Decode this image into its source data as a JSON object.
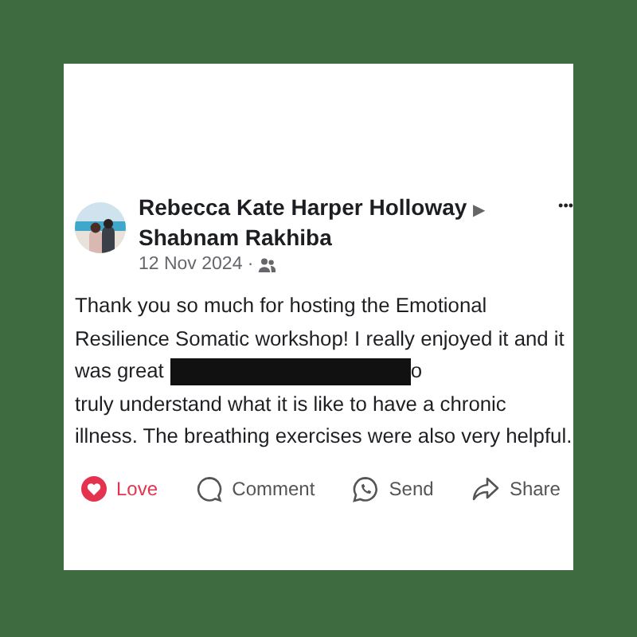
{
  "post": {
    "author": "Rebecca Kate Harper Holloway",
    "separator": "▶",
    "recipient": "Shabnam Rakhiba",
    "date": "12 Nov 2024 ·",
    "more": "•••",
    "lines": [
      {
        "text": "Thank you so much for hosting the Emotional",
        "redacted": false
      },
      {
        "text": "Resilience Somatic workshop! I really enjoyed it and it",
        "redacted": false
      },
      {
        "text": "was great",
        "redacted": true,
        "tail": "o"
      },
      {
        "text": "truly understand what it is like to have a chronic",
        "redacted": false
      },
      {
        "text": "illness. The breathing exercises were also very helpful.",
        "redacted": false
      }
    ],
    "actions": [
      {
        "kind": "love",
        "label": "Love",
        "selected": true
      },
      {
        "kind": "comment",
        "label": "Comment",
        "selected": false
      },
      {
        "kind": "send",
        "label": "Send",
        "selected": false
      },
      {
        "kind": "share",
        "label": "Share",
        "selected": false
      }
    ]
  }
}
